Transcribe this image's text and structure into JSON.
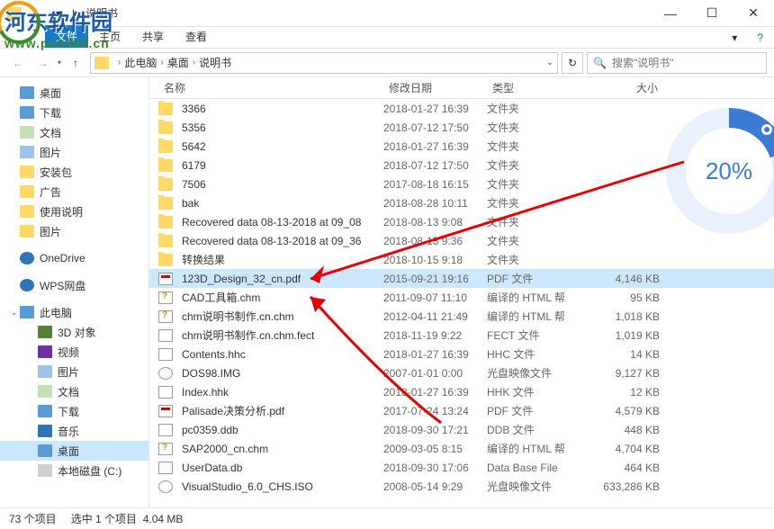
{
  "window": {
    "title": "说明书",
    "separator": "|"
  },
  "ribbon": {
    "tabs": [
      "主页",
      "共享",
      "查看"
    ],
    "expand_icon": "▾"
  },
  "nav": {
    "back": "←",
    "forward": "→",
    "up": "↑",
    "refresh": "↻"
  },
  "breadcrumb": {
    "root": "此电脑",
    "items": [
      "桌面",
      "说明书"
    ]
  },
  "search": {
    "placeholder": "搜索\"说明书\"",
    "icon": "🔍"
  },
  "tree": {
    "sections": [
      {
        "items": [
          {
            "label": "桌面",
            "icon": "desktop",
            "sel": false
          },
          {
            "label": "下载",
            "icon": "download",
            "sel": false
          },
          {
            "label": "文档",
            "icon": "doc",
            "sel": false
          },
          {
            "label": "图片",
            "icon": "pic",
            "sel": false
          },
          {
            "label": "安装包",
            "icon": "folder",
            "sel": false
          },
          {
            "label": "广告",
            "icon": "folder",
            "sel": false
          },
          {
            "label": "使用说明",
            "icon": "folder",
            "sel": false
          },
          {
            "label": "图片",
            "icon": "folder",
            "sel": false
          }
        ]
      },
      {
        "items": [
          {
            "label": "OneDrive",
            "icon": "cloud"
          }
        ]
      },
      {
        "items": [
          {
            "label": "WPS网盘",
            "icon": "cloud"
          }
        ]
      },
      {
        "items": [
          {
            "label": "此电脑",
            "icon": "pc",
            "expanded": true
          },
          {
            "label": "3D 对象",
            "icon": "obj3d",
            "sub": true
          },
          {
            "label": "视频",
            "icon": "video",
            "sub": true
          },
          {
            "label": "图片",
            "icon": "pic",
            "sub": true
          },
          {
            "label": "文档",
            "icon": "doc",
            "sub": true
          },
          {
            "label": "下载",
            "icon": "download",
            "sub": true
          },
          {
            "label": "音乐",
            "icon": "music",
            "sub": true
          },
          {
            "label": "桌面",
            "icon": "desktop",
            "sub": true,
            "sel": true
          },
          {
            "label": "本地磁盘 (C:)",
            "icon": "disk",
            "sub": true
          }
        ]
      }
    ]
  },
  "columns": {
    "name": "名称",
    "date": "修改日期",
    "type": "类型",
    "size": "大小"
  },
  "files": [
    {
      "name": "3366",
      "date": "2018-01-27 16:39",
      "type": "文件夹",
      "size": "",
      "icon": "folder"
    },
    {
      "name": "5356",
      "date": "2018-07-12 17:50",
      "type": "文件夹",
      "size": "",
      "icon": "folder"
    },
    {
      "name": "5642",
      "date": "2018-01-27 16:39",
      "type": "文件夹",
      "size": "",
      "icon": "folder"
    },
    {
      "name": "6179",
      "date": "2018-07-12 17:50",
      "type": "文件夹",
      "size": "",
      "icon": "folder"
    },
    {
      "name": "7506",
      "date": "2017-08-18 16:15",
      "type": "文件夹",
      "size": "",
      "icon": "folder"
    },
    {
      "name": "bak",
      "date": "2018-08-28 10:11",
      "type": "文件夹",
      "size": "",
      "icon": "folder"
    },
    {
      "name": "Recovered data 08-13-2018 at 09_08",
      "date": "2018-08-13 9:08",
      "type": "文件夹",
      "size": "",
      "icon": "folder"
    },
    {
      "name": "Recovered data 08-13-2018 at 09_36",
      "date": "2018-08-13 9:36",
      "type": "文件夹",
      "size": "",
      "icon": "folder"
    },
    {
      "name": "转换结果",
      "date": "2018-10-15 9:18",
      "type": "文件夹",
      "size": "",
      "icon": "folder"
    },
    {
      "name": "123D_Design_32_cn.pdf",
      "date": "2015-09-21 19:16",
      "type": "PDF 文件",
      "size": "4,146 KB",
      "icon": "pdf",
      "selected": true
    },
    {
      "name": "CAD工具箱.chm",
      "date": "2011-09-07 11:10",
      "type": "编译的 HTML 帮",
      "size": "95 KB",
      "icon": "chm"
    },
    {
      "name": "chm说明书制作.cn.chm",
      "date": "2012-04-11 21:49",
      "type": "编译的 HTML 帮",
      "size": "1,018 KB",
      "icon": "chm"
    },
    {
      "name": "chm说明书制作.cn.chm.fect",
      "date": "2018-11-19 9:22",
      "type": "FECT 文件",
      "size": "1,019 KB",
      "icon": "generic"
    },
    {
      "name": "Contents.hhc",
      "date": "2018-01-27 16:39",
      "type": "HHC 文件",
      "size": "14 KB",
      "icon": "generic"
    },
    {
      "name": "DOS98.IMG",
      "date": "2007-01-01 0:00",
      "type": "光盘映像文件",
      "size": "9,127 KB",
      "icon": "iso"
    },
    {
      "name": "Index.hhk",
      "date": "2018-01-27 16:39",
      "type": "HHK 文件",
      "size": "12 KB",
      "icon": "generic"
    },
    {
      "name": "Palisade决策分析.pdf",
      "date": "2017-07-24 13:24",
      "type": "PDF 文件",
      "size": "4,579 KB",
      "icon": "pdf"
    },
    {
      "name": "pc0359.ddb",
      "date": "2018-09-30 17:21",
      "type": "DDB 文件",
      "size": "448 KB",
      "icon": "generic"
    },
    {
      "name": "SAP2000_cn.chm",
      "date": "2009-03-05 8:15",
      "type": "编译的 HTML 帮",
      "size": "4,704 KB",
      "icon": "chm"
    },
    {
      "name": "UserData.db",
      "date": "2018-09-30 17:06",
      "type": "Data Base File",
      "size": "464 KB",
      "icon": "generic"
    },
    {
      "name": "VisualStudio_6.0_CHS.ISO",
      "date": "2008-05-14 9:29",
      "type": "光盘映像文件",
      "size": "633,286 KB",
      "icon": "iso"
    }
  ],
  "status": {
    "count": "73 个项目",
    "selection": "选中 1 个项目",
    "size": "4.04 MB"
  },
  "overlay": {
    "site_name": "河东软件园",
    "site_url": "www.pc0359.cn",
    "percent": "20%"
  }
}
